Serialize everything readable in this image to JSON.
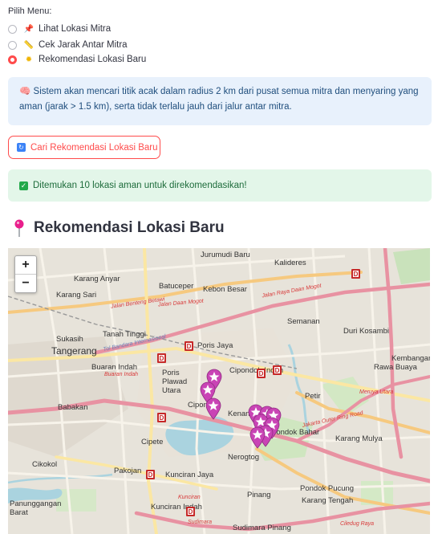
{
  "menu": {
    "label": "Pilih Menu:",
    "options": [
      {
        "label": "Lihat Lokasi Mitra",
        "icon": "pushpin-icon",
        "selected": false
      },
      {
        "label": "Cek Jarak Antar Mitra",
        "icon": "ruler-icon",
        "selected": false
      },
      {
        "label": "Rekomendasi Lokasi Baru",
        "icon": "sparkle-icon",
        "selected": true
      }
    ]
  },
  "info": {
    "icon": "brain-icon",
    "text": "Sistem akan mencari titik acak dalam radius 2 km dari pusat semua mitra dan menyaring yang aman (jarak > 1.5 km), serta tidak terlalu jauh dari jalur antar mitra."
  },
  "button": {
    "label": "Cari Rekomendasi Lokasi Baru",
    "icon": "refresh-icon"
  },
  "success": {
    "text": "Ditemukan 10 lokasi aman untuk direkomendasikan!",
    "icon": "check-icon"
  },
  "heading": {
    "text": "Rekomendasi Lokasi Baru",
    "icon": "pin-icon"
  },
  "map": {
    "zoom_in": "+",
    "zoom_out": "−",
    "colors": {
      "star_marker": "#c944b5",
      "mitra_marker": "#c62828",
      "water": "#aad3df",
      "motorway": "#e892a2"
    },
    "places": [
      {
        "name": "Jurumudi Baru",
        "cls": "big"
      },
      {
        "name": "Kalideres",
        "cls": "big"
      },
      {
        "name": "Karang Anyar",
        "cls": "big"
      },
      {
        "name": "Batuceper",
        "cls": "big"
      },
      {
        "name": "Kebon Besar",
        "cls": "big"
      },
      {
        "name": "Karang Sari",
        "cls": "big"
      },
      {
        "name": "Semanan",
        "cls": "big"
      },
      {
        "name": "Tanah Tinggi",
        "cls": "big"
      },
      {
        "name": "Poris Jaya",
        "cls": "big"
      },
      {
        "name": "Poris Plawad Utara",
        "cls": "big"
      },
      {
        "name": "Duri Kosambi",
        "cls": "big"
      },
      {
        "name": "Sukasih",
        "cls": "big"
      },
      {
        "name": "Tangerang",
        "cls": "big"
      },
      {
        "name": "Buaran Indah",
        "cls": "big"
      },
      {
        "name": "Cipondoh Indah",
        "cls": "big"
      },
      {
        "name": "Rawa Buaya",
        "cls": "big"
      },
      {
        "name": "Babakan",
        "cls": "big"
      },
      {
        "name": "Cipondoh",
        "cls": "big"
      },
      {
        "name": "Karang Mulya",
        "cls": "big"
      },
      {
        "name": "Kenanga",
        "cls": "big"
      },
      {
        "name": "Pondok Bahar",
        "cls": "big"
      },
      {
        "name": "Cipete",
        "cls": "big"
      },
      {
        "name": "Nerogtog",
        "cls": "big"
      },
      {
        "name": "Cikokol",
        "cls": "big"
      },
      {
        "name": "Pakojan",
        "cls": "big"
      },
      {
        "name": "Kunciran Jaya",
        "cls": "big"
      },
      {
        "name": "Pondok Pucung",
        "cls": "big"
      },
      {
        "name": "Pinang",
        "cls": "big"
      },
      {
        "name": "Karang Tengah",
        "cls": "big"
      },
      {
        "name": "Panunggangan Barat",
        "cls": "big"
      },
      {
        "name": "Kunciran Indah",
        "cls": "big"
      },
      {
        "name": "Sudimara Pinang",
        "cls": "big"
      },
      {
        "name": "Petir",
        "cls": "big"
      },
      {
        "name": "Kembangan Utara",
        "cls": "big"
      }
    ],
    "road_labels": [
      "Jalan Daan Mogot",
      "Jalan Raya Daan Mogot",
      "Tol Bandara Internasional",
      "Jalan Benteng Betawi",
      "Buaran Indah",
      "Meruya Utara",
      "Kunciran",
      "Sudimara",
      "Ciledug Raya",
      "Jakarta Outer Ring Road"
    ],
    "mitra_markers": 8,
    "recommended_points": 10
  }
}
